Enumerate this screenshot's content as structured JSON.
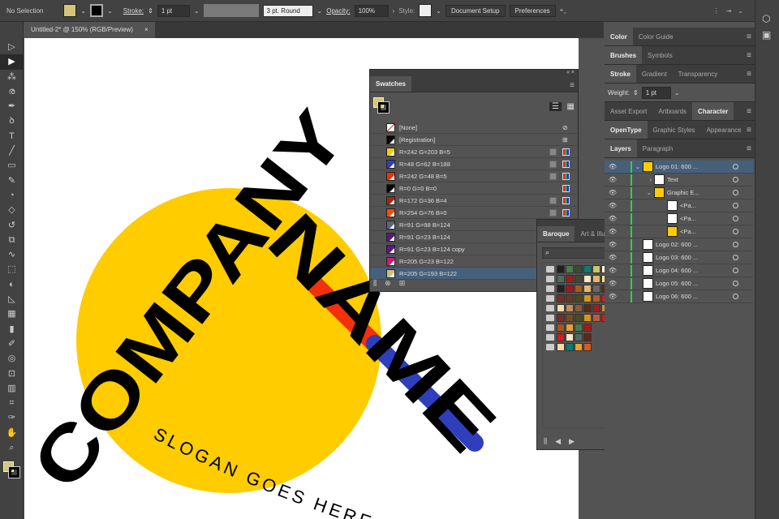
{
  "control_bar": {
    "selection": "No Selection",
    "stroke_label": "Stroke:",
    "stroke_value": "1 pt",
    "brush": "3 pt. Round",
    "opacity_label": "Opacity:",
    "opacity_value": "100%",
    "style_label": "Style:",
    "document_setup": "Document Setup",
    "preferences": "Preferences",
    "fill_color": "#d6c47a"
  },
  "document_tab": {
    "title": "Untitled-2* @ 150% (RGB/Preview)",
    "close": "×"
  },
  "tools": [
    "selection-tool",
    "direct-selection-tool",
    "magic-wand-tool",
    "lasso-tool",
    "pen-tool",
    "curvature-tool",
    "type-tool",
    "line-tool",
    "rectangle-tool",
    "paintbrush-tool",
    "blob-brush-tool",
    "eraser-tool",
    "rotate-tool",
    "scale-tool",
    "warp-tool",
    "free-transform-tool",
    "shape-builder-tool",
    "perspective-grid-tool",
    "mesh-tool",
    "gradient-tool",
    "eyedropper-tool",
    "blend-tool",
    "symbol-sprayer-tool",
    "column-graph-tool",
    "artboard-tool",
    "slice-tool",
    "hand-tool",
    "zoom-tool"
  ],
  "artwork": {
    "company": "COMPANY",
    "name": "NAME",
    "slogan": "SLOGAN GOES HERE",
    "colors": {
      "yellow": "#ffcc00",
      "red": "#f2300a",
      "blue": "#2f3ebc",
      "black": "#000000"
    }
  },
  "swatches": {
    "tab": "Swatches",
    "items": [
      {
        "label": "[None]",
        "color": "none"
      },
      {
        "label": "[Registration]",
        "color": "#000000"
      },
      {
        "label": "R=242 G=203 B=5",
        "color": "#f2cb05",
        "global": true
      },
      {
        "label": "R=48 G=62 B=188",
        "color": "#303ebc",
        "global": true
      },
      {
        "label": "R=242 G=48 B=5",
        "color": "#f23005",
        "global": true
      },
      {
        "label": "R=0 G=0 B=0",
        "color": "#000000",
        "global": false
      },
      {
        "label": "R=172 G=36 B=4",
        "color": "#ac2404",
        "global": true
      },
      {
        "label": "R=254 G=76 B=0",
        "color": "#fe4c00",
        "global": true
      },
      {
        "label": "R=91 G=98 B=124",
        "color": "#5b627c",
        "global": true
      },
      {
        "label": "R=91 G=23 B=124",
        "color": "#5b177c",
        "global": true
      },
      {
        "label": "R=91 G=23 B=124 copy",
        "color": "#5b177c",
        "global": true
      },
      {
        "label": "R=205 G=23 B=122",
        "color": "#cd177a",
        "global": true
      },
      {
        "label": "R=205 G=193 B=122",
        "color": "#cdc17a",
        "global": true,
        "selected": true
      }
    ]
  },
  "baroque": {
    "tabs": [
      "Baroque",
      "Art & Illustration"
    ],
    "rows": [
      [
        "#222018",
        "#4a7a4e",
        "#3c4a32",
        "#0e7a72",
        "#c8c86a",
        "#fff8e0",
        "#fccc5a",
        "#f08a1a",
        "#d85a1c"
      ],
      [
        "#4e6a62",
        "#98201a",
        "#3c4a32",
        "#fde8c8",
        "#e8b46a",
        "#fde090",
        "#2a2010",
        "#6a3a2a"
      ],
      [
        "#222222",
        "#a01a1a",
        "#a85a1a",
        "#e8b878",
        "#6a6a6a",
        "#5a2a1a",
        "#e8a030"
      ],
      [
        "#7a2a2a",
        "#6a3a1a",
        "#4a4a1a",
        "#d8961a",
        "#b85a2a",
        "#d81a1a"
      ],
      [
        "#fcd8a8",
        "#c88a5a",
        "#8a5a3a",
        "#5a2a1a",
        "#a81a1a",
        "#c8963a"
      ],
      [
        "#7a2a2a",
        "#7a4a1a",
        "#4a4a1a",
        "#d8961a",
        "#c05a3a",
        "#d81a1a"
      ],
      [
        "#a8561a",
        "#e8a030",
        "#4a7a4e",
        "#a81a1a"
      ],
      [
        "#d81a1a",
        "#fde8c8",
        "#4e6a62",
        "#5a2a1a"
      ],
      [
        "#fcd8a8",
        "#0e7a72",
        "#e8a030",
        "#d85a1c"
      ]
    ]
  },
  "dock": {
    "groups": [
      [
        "Color",
        "Color Guide"
      ],
      [
        "Brushes",
        "Symbols"
      ],
      [
        "Stroke",
        "Gradient",
        "Transparency"
      ]
    ],
    "weight_label": "Weight:",
    "weight_value": "1 pt",
    "groups2": [
      [
        "Asset Export",
        "Artboards",
        "Character"
      ],
      [
        "OpenType",
        "Graphic Styles",
        "Appearance"
      ],
      [
        "Layers",
        "Paragraph"
      ]
    ],
    "layers": [
      {
        "label": "Logo 01: 600 ..."
      },
      {
        "label": "Text"
      },
      {
        "label": "Graphic E..."
      },
      {
        "label": "<Pa..."
      },
      {
        "label": "<Pa..."
      },
      {
        "label": "<Pa..."
      },
      {
        "label": "Logo 02: 600 ..."
      },
      {
        "label": "Logo 03: 600 ..."
      },
      {
        "label": "Logo 04: 600 ..."
      },
      {
        "label": "Logo 05: 600 ..."
      },
      {
        "label": "Logo 06: 600 ..."
      }
    ]
  }
}
